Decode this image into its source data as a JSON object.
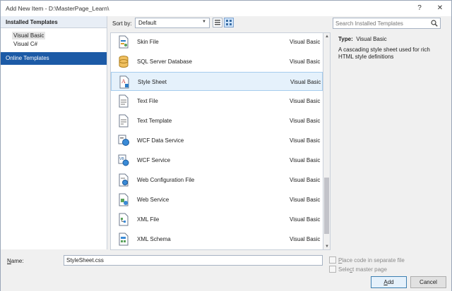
{
  "window": {
    "title": "Add New Item - D:\\MasterPage_Learn\\",
    "help_label": "?",
    "close_label": "✕"
  },
  "left_pane": {
    "header": "Installed Templates",
    "items": [
      "Visual Basic",
      "Visual C#"
    ],
    "selected": "Visual Basic",
    "online": "Online Templates"
  },
  "toolbar": {
    "sort_label": "Sort by:",
    "sort_value": "Default",
    "search_placeholder": "Search Installed Templates"
  },
  "templates": [
    {
      "name": "Skin File",
      "lang": "Visual Basic",
      "icon": "skin-file-icon"
    },
    {
      "name": "SQL Server Database",
      "lang": "Visual Basic",
      "icon": "database-icon"
    },
    {
      "name": "Style Sheet",
      "lang": "Visual Basic",
      "icon": "style-sheet-icon",
      "selected": true
    },
    {
      "name": "Text File",
      "lang": "Visual Basic",
      "icon": "text-file-icon"
    },
    {
      "name": "Text Template",
      "lang": "Visual Basic",
      "icon": "text-template-icon"
    },
    {
      "name": "WCF Data Service",
      "lang": "Visual Basic",
      "icon": "wcf-data-service-icon"
    },
    {
      "name": "WCF Service",
      "lang": "Visual Basic",
      "icon": "wcf-service-icon"
    },
    {
      "name": "Web Configuration File",
      "lang": "Visual Basic",
      "icon": "web-config-icon"
    },
    {
      "name": "Web Service",
      "lang": "Visual Basic",
      "icon": "web-service-icon"
    },
    {
      "name": "XML File",
      "lang": "Visual Basic",
      "icon": "xml-file-icon"
    },
    {
      "name": "XML Schema",
      "lang": "Visual Basic",
      "icon": "xml-schema-icon"
    }
  ],
  "details": {
    "type_label": "Type:",
    "type_value": "Visual Basic",
    "description": "A cascading style sheet used for rich HTML style definitions"
  },
  "bottom": {
    "name_label_n": "N",
    "name_label_rest": "ame:",
    "name_value": "StyleSheet.css",
    "chk1_label_a": "",
    "chk1_label_u": "P",
    "chk1_label_b": "lace code in separate file",
    "chk2_label_a": "Sele",
    "chk2_label_u": "c",
    "chk2_label_b": "t master page",
    "add_u": "A",
    "add_rest": "dd",
    "cancel_label": "Cancel"
  },
  "colors": {
    "online_bg": "#1c5aa6",
    "selected_row": "#e5f1fb"
  }
}
